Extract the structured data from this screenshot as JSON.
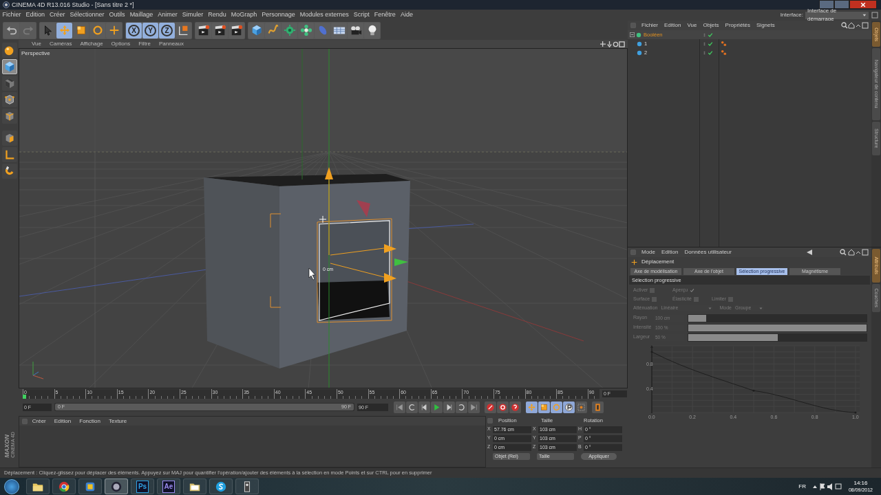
{
  "window": {
    "title": "CINEMA 4D R13.016 Studio - [Sans titre 2 *]"
  },
  "menu_bar": [
    "Fichier",
    "Edition",
    "Créer",
    "Sélectionner",
    "Outils",
    "Maillage",
    "Animer",
    "Simuler",
    "Rendu",
    "MoGraph",
    "Personnage",
    "Modules externes",
    "Script",
    "Fenêtre",
    "Aide"
  ],
  "interface": {
    "label": "Interface:",
    "value": "Interface de démarrage"
  },
  "toolbar": [
    [
      {
        "kind": "undo",
        "selected": false,
        "disabled": false
      },
      {
        "kind": "redo",
        "selected": false,
        "disabled": true
      }
    ],
    [
      {
        "kind": "select",
        "selected": false
      },
      {
        "kind": "move",
        "selected": true
      },
      {
        "kind": "scale",
        "selected": false
      },
      {
        "kind": "rotate",
        "selected": false
      },
      {
        "kind": "add",
        "selected": false
      }
    ],
    [
      {
        "kind": "axis",
        "label": "X",
        "selected": true
      },
      {
        "kind": "axis",
        "label": "Y",
        "selected": true
      },
      {
        "kind": "axis",
        "label": "Z",
        "selected": true
      },
      {
        "kind": "coords",
        "selected": false
      }
    ],
    [
      {
        "kind": "clapper",
        "selected": false
      },
      {
        "kind": "clapper",
        "selected": false
      },
      {
        "kind": "clapper",
        "selected": false
      }
    ],
    [
      {
        "kind": "cube",
        "selected": false
      },
      {
        "kind": "spline",
        "selected": false
      },
      {
        "kind": "gear",
        "selected": false
      },
      {
        "kind": "flower",
        "selected": false
      },
      {
        "kind": "ellipse",
        "selected": false
      },
      {
        "kind": "floor",
        "selected": false
      },
      {
        "kind": "camera",
        "selected": false
      },
      {
        "kind": "bulb",
        "selected": false
      }
    ]
  ],
  "left_tools": [
    {
      "kind": "sphere",
      "selected": false
    },
    {
      "kind": "cube",
      "selected": true
    },
    {
      "kind": "checker",
      "selected": false
    },
    {
      "kind": "points",
      "selected": false
    },
    {
      "kind": "edges",
      "selected": false
    },
    {
      "kind": "polygons",
      "selected": false
    },
    {
      "kind": "corner",
      "selected": false
    },
    {
      "kind": "magnet",
      "selected": false
    }
  ],
  "viewport": {
    "menu": [
      "Vue",
      "Caméras",
      "Affichage",
      "Options",
      "Filtre",
      "Panneaux"
    ],
    "view_name": "Perspective",
    "measure": "0 cm"
  },
  "timeline": {
    "ticks": [
      "0",
      "5",
      "10",
      "15",
      "20",
      "25",
      "30",
      "35",
      "40",
      "45",
      "50",
      "55",
      "60",
      "65",
      "70",
      "75",
      "80",
      "85",
      "90"
    ],
    "playhead": {
      "level": 0
    },
    "current_frame": "0 F",
    "start": "0 F",
    "range": {
      "start": "0 F",
      "end": "90 F",
      "level": 1
    },
    "end": "90 F",
    "controls": [
      {
        "kind": "first"
      },
      {
        "kind": "loop"
      },
      {
        "kind": "prev"
      },
      {
        "kind": "play"
      },
      {
        "kind": "next"
      },
      {
        "kind": "loop2"
      },
      {
        "kind": "last"
      },
      {
        "kind": "record"
      },
      {
        "kind": "autokey"
      },
      {
        "kind": "help"
      },
      {
        "kind": "move"
      },
      {
        "kind": "scale"
      },
      {
        "kind": "rotate"
      },
      {
        "kind": "param"
      },
      {
        "kind": "grid"
      },
      {
        "kind": "film"
      }
    ]
  },
  "material_manager": {
    "menu": [
      "Créer",
      "Edition",
      "Fonction",
      "Texture"
    ]
  },
  "logo": [
    "MAXON",
    "CINEMA 4D"
  ],
  "coordinates": {
    "headers": [
      "Position",
      "Taille",
      "Rotation"
    ],
    "rows": [
      {
        "axis": "X",
        "position": "57.76 cm",
        "size_axis": "X",
        "size": "103 cm",
        "rot_axis": "H",
        "rotation": "0 °"
      },
      {
        "axis": "Y",
        "position": "0 cm",
        "size_axis": "Y",
        "size": "103 cm",
        "rot_axis": "P",
        "rotation": "0 °"
      },
      {
        "axis": "Z",
        "position": "0 cm",
        "size_axis": "Z",
        "size": "103 cm",
        "rot_axis": "B",
        "rotation": "0 °"
      }
    ],
    "mode": "Objet (Rel)",
    "size_mode": "Taille",
    "apply": "Appliquer"
  },
  "objects": {
    "menu": [
      "Fichier",
      "Edition",
      "Vue",
      "Objets",
      "Propriétés",
      "Signets"
    ],
    "tree": [
      {
        "name": "Booléen",
        "selected": true,
        "expanded": true,
        "tag": false,
        "children": [
          {
            "name": "1",
            "selected": false,
            "tag": true
          },
          {
            "name": "2",
            "selected": false,
            "tag": true
          }
        ]
      }
    ],
    "side_tabs": [
      {
        "label": "Objets",
        "selected": true
      },
      {
        "label": "Navigateur de contenu",
        "selected": false
      },
      {
        "label": "Structure",
        "selected": false
      }
    ]
  },
  "attributes": {
    "menu": [
      "Mode",
      "Edition",
      "Données utilisateur"
    ],
    "title": "Déplacement",
    "tabs": [
      {
        "label": "Axe de modélisation",
        "selected": false
      },
      {
        "label": "Axe de l'objet",
        "selected": false
      },
      {
        "label": "Sélection progressive",
        "selected": true
      },
      {
        "label": "Magnétisme",
        "selected": false
      }
    ],
    "section": "Sélection progressive",
    "disabled": true,
    "checkbox_rows": [
      [
        {
          "label": "Activer",
          "checked": false
        },
        {
          "label": "Aperçu",
          "checked": true
        }
      ],
      [
        {
          "label": "Surface",
          "checked": false
        },
        {
          "label": "Élasticité",
          "checked": false
        },
        {
          "label": "Limiter",
          "checked": false
        }
      ]
    ],
    "dropdowns": [
      {
        "label": "Atténuation",
        "value": "Linéaire"
      },
      {
        "label": "Mode",
        "value": "Groupe"
      }
    ],
    "sliders": [
      {
        "label": "Rayon",
        "value": "100 cm",
        "level": 0.1
      },
      {
        "label": "Intensité",
        "value": "100 %",
        "level": 1
      },
      {
        "label": "Largeur",
        "value": "50 %",
        "level": 0.5
      }
    ],
    "chart_data": {
      "type": "line",
      "grid": true,
      "x": [
        0,
        0.5,
        1
      ],
      "series": [
        {
          "color": "#1e1e1e",
          "values": [
            1,
            0.36,
            0
          ]
        }
      ],
      "xlim": [
        0,
        1
      ],
      "ylim": [
        0,
        1.1
      ],
      "xticks": [
        {
          "value": 0,
          "label": "0.0"
        },
        {
          "value": 0.2,
          "label": "0.2"
        },
        {
          "value": 0.4,
          "label": "0.4"
        },
        {
          "value": 0.6,
          "label": "0.6"
        },
        {
          "value": 0.8,
          "label": "0.8"
        },
        {
          "value": 1,
          "label": "1.0"
        }
      ],
      "yticks": [
        0.4,
        0.8
      ]
    },
    "side_tabs": [
      {
        "label": "Attributs",
        "selected": true
      },
      {
        "label": "Couches",
        "selected": false
      }
    ]
  },
  "status_bar": "Déplacement : Cliquez-glissez pour déplacer des éléments. Appuyez sur MAJ pour quantifier l'opération/ajouter des éléments à la sélection en mode Points et sur CTRL pour en supprimer",
  "taskbar": {
    "apps": [
      {
        "kind": "folder",
        "selected": false
      },
      {
        "kind": "chrome",
        "selected": false
      },
      {
        "kind": "square",
        "selected": false
      },
      {
        "kind": "c4d",
        "selected": true
      },
      {
        "kind": "letters",
        "label": "Ps",
        "color": "#2fa3e6",
        "selected": false
      },
      {
        "kind": "letters",
        "label": "Ae",
        "color": "#9b8cf0",
        "selected": false
      },
      {
        "kind": "folder2",
        "selected": false
      },
      {
        "kind": "skype",
        "selected": false
      },
      {
        "kind": "torch",
        "selected": false
      }
    ],
    "language": "FR",
    "time": "14:16",
    "date": "08/09/2012"
  }
}
